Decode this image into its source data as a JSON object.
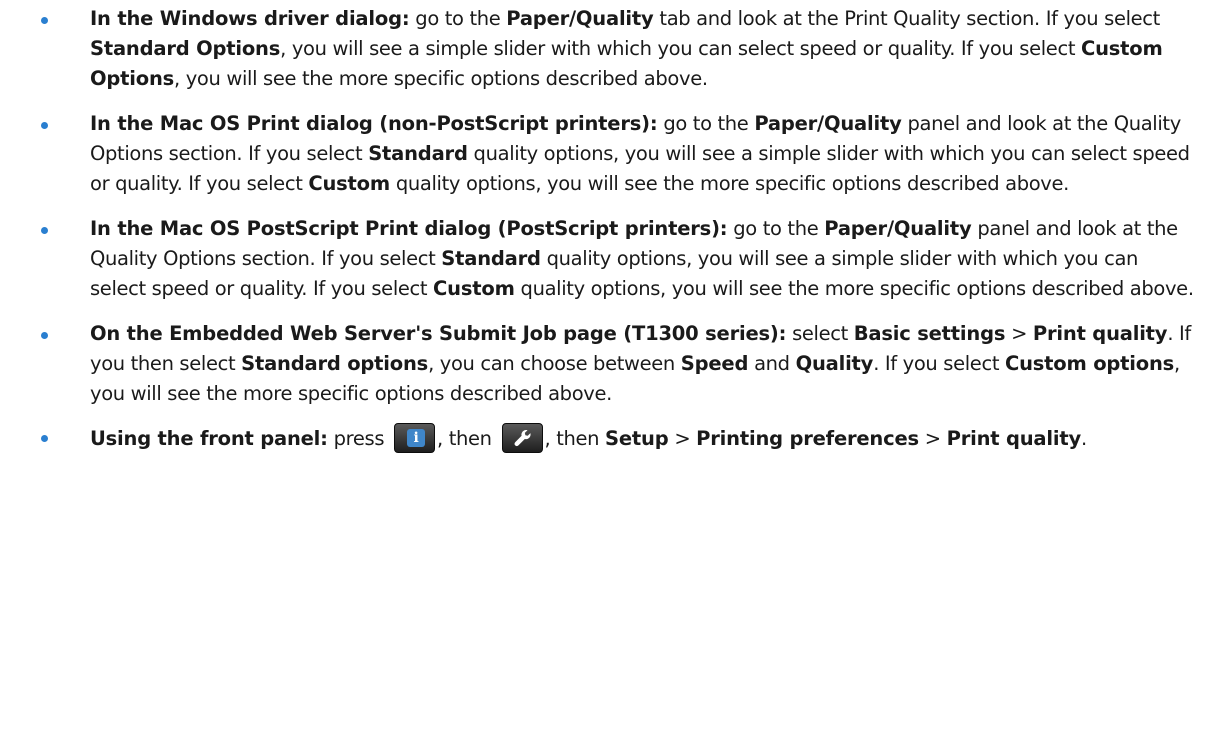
{
  "items": [
    {
      "lead": "In the Windows driver dialog:",
      "t1": " go to the ",
      "b1": "Paper/Quality",
      "t2": " tab and look at the Print Quality section. If you select ",
      "b2": "Standard Options",
      "t3": ", you will see a simple slider with which you can select speed or quality. If you select ",
      "b3": "Custom Options",
      "t4": ", you will see the more specific options described above."
    },
    {
      "lead": "In the Mac OS Print dialog (non-PostScript printers):",
      "t1": " go to the ",
      "b1": "Paper/Quality",
      "t2": " panel and look at the Quality Options section. If you select ",
      "b2": "Standard",
      "t3": " quality options, you will see a simple slider with which you can select speed or quality. If you select ",
      "b3": "Custom",
      "t4": " quality options, you will see the more specific options described above."
    },
    {
      "lead": "In the Mac OS PostScript Print dialog (PostScript printers):",
      "t1": " go to the ",
      "b1": "Paper/Quality",
      "t2": " panel and look at the Quality Options section. If you select ",
      "b2": "Standard",
      "t3": " quality options, you will see a simple slider with which you can select speed or quality. If you select ",
      "b3": "Custom",
      "t4": " quality options, you will see the more specific options described above."
    },
    {
      "lead": "On the Embedded Web Server's Submit Job page (T1300 series):",
      "t1": " select ",
      "b1": "Basic settings",
      "t2": " > ",
      "b2": "Print quality",
      "t3": ". If you then select ",
      "b3": "Standard options",
      "t4": ", you can choose between ",
      "b4": "Speed",
      "t5": " and ",
      "b5": "Quality",
      "t6": ". If you select ",
      "b6": "Custom options",
      "t7": ", you will see the more specific options described above."
    },
    {
      "lead": "Using the front panel:",
      "t1": " press ",
      "t2": ", then ",
      "t3": ", then ",
      "b1": "Setup",
      "t4": " > ",
      "b2": "Printing preferences",
      "t5": " > ",
      "b3": "Print quality",
      "t6": "."
    }
  ],
  "icons": {
    "info_glyph": "i",
    "info_icon": "info-icon",
    "wrench_icon": "wrench-icon"
  },
  "colors": {
    "bullet": "#2a7fd0",
    "text": "#1a1a1a"
  }
}
